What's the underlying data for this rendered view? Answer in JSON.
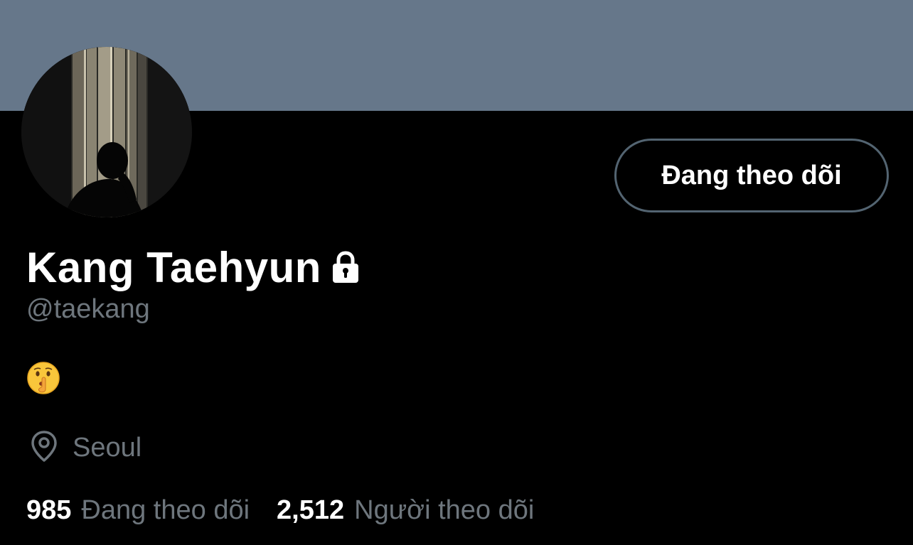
{
  "profile": {
    "display_name": "Kang Taehyun",
    "protected_icon": "lock-icon",
    "handle": "@taekang",
    "bio_emoji": "shushing-face-emoji",
    "location": "Seoul",
    "location_icon": "location-pin-icon"
  },
  "actions": {
    "follow_button_label": "Đang theo dõi"
  },
  "stats": {
    "following_count": "985",
    "following_label": "Đang theo dõi",
    "followers_count": "2,512",
    "followers_label": "Người theo dõi"
  },
  "colors": {
    "banner": "#66778a",
    "background": "#000000",
    "secondary_text": "#6e767d",
    "button_border": "#536471"
  }
}
